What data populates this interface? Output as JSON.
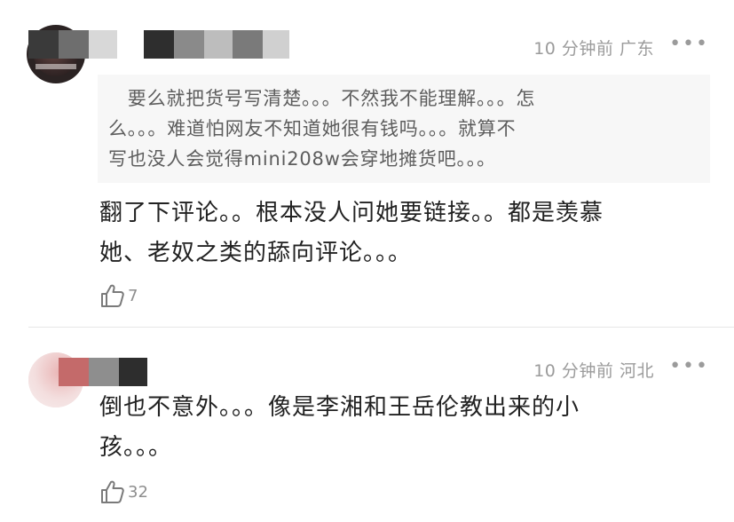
{
  "comments": [
    {
      "time": "10 分钟前",
      "location": "广东",
      "more": "•••",
      "quoted": "要么就把货号写清楚。。。不然我不能理解。。。怎么。。。难道怕网友不知道她很有钱吗。。。就算不写也没人会觉得mini208w会穿地摊货吧。。。",
      "quoted_lines": [
        "　要么就把货号写清楚。。。不然我不能理解。。。怎",
        "么。。。难道怕网友不知道她很有钱吗。。。就算不",
        "写也没人会觉得mini208w会穿地摊货吧。。。"
      ],
      "body_lines": [
        "翻了下评论。。根本没人问她要链接。。都是羡慕",
        "她、老奴之类的舔向评论。。。"
      ],
      "likes": "7",
      "username_mosaic": [
        "#3a3a3a",
        "#6e6e6e",
        "#d8d8d8",
        "#ffffff",
        "#2e2e2e",
        "#8a8a8a",
        "#bdbdbd",
        "#7a7a7a",
        "#d0d0d0"
      ]
    },
    {
      "time": "10 分钟前",
      "location": "河北",
      "more": "•••",
      "body_lines": [
        "倒也不意外。。。像是李湘和王岳伦教出来的小",
        "孩。。。"
      ],
      "likes": "32",
      "username_mosaic": [
        "#c46a6a",
        "#8e8e8e",
        "#2d2d2d"
      ]
    }
  ],
  "icons": {
    "like": "thumbs-up-icon",
    "more": "more-dots-icon"
  }
}
